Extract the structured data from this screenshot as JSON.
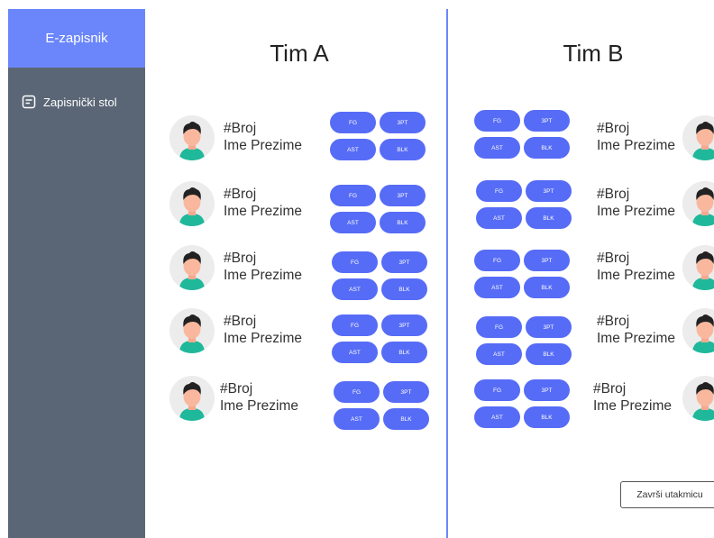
{
  "app": {
    "title": "E-zapisnik"
  },
  "sidebar": {
    "items": [
      {
        "label": "Zapisnički stol",
        "icon": "document-icon"
      }
    ]
  },
  "teams": {
    "a": {
      "name": "Tim A"
    },
    "b": {
      "name": "Tim B"
    }
  },
  "player": {
    "number": "#Broj",
    "name": "Ime Prezime"
  },
  "stat_labels": {
    "fg": "FG",
    "three": "3PT",
    "ast": "AST",
    "blk": "BLK"
  },
  "actions": {
    "finish": "Završi utakmicu"
  },
  "colors": {
    "accent": "#6b86fb",
    "button": "#566cf6",
    "sidebar": "#5a6676"
  }
}
